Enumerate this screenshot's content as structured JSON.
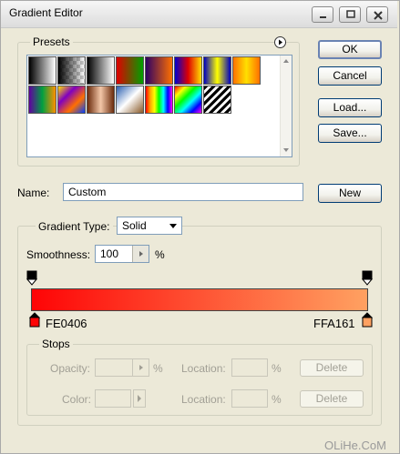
{
  "window": {
    "title": "Gradient Editor",
    "minimize_label": "minimize",
    "maximize_label": "maximize",
    "close_label": "close"
  },
  "buttons": {
    "ok": "OK",
    "cancel": "Cancel",
    "load": "Load...",
    "save": "Save...",
    "new": "New"
  },
  "presets": {
    "label": "Presets",
    "menu_icon": "circle-arrow-right-icon",
    "swatches": [
      {
        "name": "foreground-to-background",
        "css": "linear-gradient(to right,#000,#fff)"
      },
      {
        "name": "foreground-to-transparent",
        "css": "linear-gradient(to right,#000,rgba(0,0,0,0)),repeating-conic-gradient(#ccc 0 25%,#fff 0 50%) 0 0/8px 8px"
      },
      {
        "name": "black-white",
        "css": "linear-gradient(to right,#000,#fff)"
      },
      {
        "name": "red-green",
        "css": "linear-gradient(to right,#e00000,#00a000)"
      },
      {
        "name": "violet-orange",
        "css": "linear-gradient(to right,#2e0064,#ff7000)"
      },
      {
        "name": "blue-red-yellow",
        "css": "linear-gradient(to right,#0000d0,#e00000,#ffe000)"
      },
      {
        "name": "blue-yellow-blue",
        "css": "linear-gradient(to right,#0000c0,#ffff00,#0000c0)"
      },
      {
        "name": "orange-yellow-orange",
        "css": "linear-gradient(to right,#ff7000,#ffe000,#ff7000)"
      },
      {
        "name": "violet-green-orange",
        "css": "linear-gradient(to right,#6000a0,#00a040,#ff9000)"
      },
      {
        "name": "yellow-violet-orange-blue",
        "css": "linear-gradient(135deg,#ffe000,#8000c0,#ff7000,#0040ff)"
      },
      {
        "name": "copper",
        "css": "linear-gradient(to right,#6b2b0c,#f3c7a8,#6b2b0c)"
      },
      {
        "name": "chrome",
        "css": "linear-gradient(135deg,#2a5fb0,#ffffff 50%,#8a5a28)"
      },
      {
        "name": "spectrum",
        "css": "linear-gradient(to right,red,orange,yellow,lime,cyan,blue,magenta)"
      },
      {
        "name": "transparent-rainbow",
        "css": "linear-gradient(135deg,red,yellow,lime,cyan,blue,magenta)"
      },
      {
        "name": "transparent-stripes",
        "css": "repeating-linear-gradient(135deg,#000 0 3px,#fff 3px 6px)"
      }
    ]
  },
  "name_field": {
    "label": "Name:",
    "value": "Custom"
  },
  "gradient": {
    "type_label": "Gradient Type:",
    "type_value": "Solid",
    "smoothness_label": "Smoothness:",
    "smoothness_value": "100",
    "percent": "%",
    "start_color": "#FE0406",
    "end_color": "#FFA161",
    "start_label": "FE0406",
    "end_label": "FFA161"
  },
  "stops": {
    "label": "Stops",
    "opacity_label": "Opacity:",
    "color_label": "Color:",
    "location_label_1": "Location:",
    "location_label_2": "Location:",
    "percent": "%",
    "delete_label_1": "Delete",
    "delete_label_2": "Delete"
  },
  "watermark": "OLiHe.CoM"
}
